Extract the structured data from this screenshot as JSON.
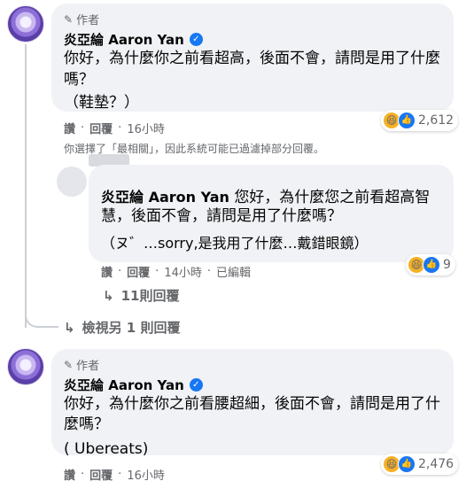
{
  "comment1": {
    "badge": "作者",
    "author": "炎亞綸 Aaron Yan",
    "text_line1": "你好，為什麼你之前看超高，後面不會，請問是用了什麼",
    "text_line2": "嗎？",
    "text_line3": "（鞋墊？）",
    "actions": {
      "like": "讚",
      "reply": "回覆",
      "time": "16小時"
    },
    "reaction_count": "2,612"
  },
  "filter_note": "你選擇了「最相關」，因此系統可能已過濾掉部分回覆。",
  "reply1": {
    "author": "炎亞綸 Aaron Yan",
    "text_line1_rest": "您好，為什麼您之前看超高智",
    "text_line2": "慧，後面不會，請問是用了什麼嗎？",
    "text_line3": "（ヌ゛…sorry,是我用了什麼…戴錯眼鏡）",
    "actions": {
      "like": "讚",
      "reply": "回覆",
      "time": "14小時",
      "edited": "已編輯"
    },
    "reaction_count": "9"
  },
  "more_replies": "11則回覆",
  "view_other": "檢視另 1 則回覆",
  "comment2": {
    "badge": "作者",
    "author": "炎亞綸 Aaron Yan",
    "text_line1": "你好，為什麼你之前看腰超細，後面不會，請問是用了什",
    "text_line2": "麼嗎？",
    "text_line3": "( Ubereats)",
    "actions": {
      "like": "讚",
      "reply": "回覆",
      "time": "16小時"
    },
    "reaction_count": "2,476"
  },
  "icons": {
    "badge": "pencil-icon",
    "verified": "verified-check-icon",
    "reply_arrow": "reply-arrow-icon",
    "reactions": [
      "haha-icon",
      "like-icon"
    ]
  },
  "colors": {
    "bubble": "#f0f2f5",
    "meta": "#65676b",
    "verified": "#1877f2",
    "thread_line": "#ccd0d5"
  }
}
